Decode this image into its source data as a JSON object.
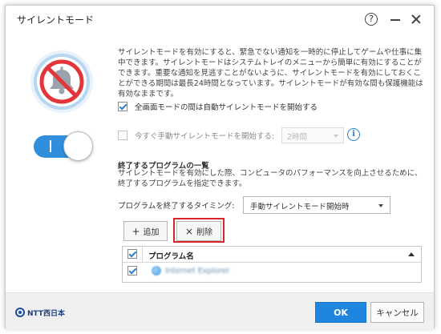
{
  "window": {
    "title": "サイレントモード",
    "help_glyph": "?"
  },
  "toggle": {
    "state": "on",
    "accent": "#2f8fdc"
  },
  "description": "サイレントモードを有効にすると、緊急でない通知を一時的に停止してゲームや仕事に集中できます。サイレントモードはシステムトレイのメニューから簡単に有効にすることができます。重要な通知を見逃すことがないように、サイレントモードを有効にしておくことができる期間は最長24時間となっています。サイレントモードが有効な間も保護機能は有効なままです。",
  "options": {
    "auto_fullscreen": {
      "label": "全画面モードの間は自動サイレントモードを開始する",
      "checked": true
    },
    "manual_start": {
      "label": "今すぐ手動サイレントモードを開始する:",
      "checked": false
    },
    "duration_select": {
      "value": "2時間",
      "disabled": true
    },
    "info_glyph": "i"
  },
  "programs": {
    "title": "終了するプログラムの一覧",
    "description": "サイレントモードを有効にした際、コンピュータのパフォーマンスを向上させるために、終了するプログラムを指定できます。",
    "timing_label": "プログラムを終了するタイミング:",
    "timing_value": "手動サイレントモード開始時",
    "add_glyph": "+",
    "add_label": "追加",
    "delete_glyph": "×",
    "delete_label": "削除",
    "table": {
      "header": "プログラム名",
      "sort": "ascending",
      "rows": [
        {
          "name": "Internet Explorer",
          "checked": true,
          "icon": "internet-explorer-icon"
        }
      ]
    }
  },
  "footer": {
    "logo": "NTT西日本",
    "ok_label": "OK",
    "cancel_label": "キャンセル",
    "ok_color": "#1f86e0"
  },
  "highlight_color": "#d6262b"
}
